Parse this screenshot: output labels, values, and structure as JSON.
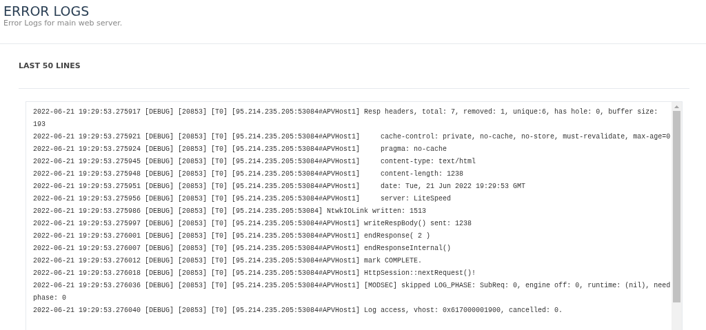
{
  "header": {
    "title": "ERROR LOGS",
    "subtitle": "Error Logs for main web server."
  },
  "panel": {
    "title": "LAST 50 LINES",
    "log_lines": [
      "2022-06-21 19:29:53.275917 [DEBUG] [20853] [T0] [95.214.235.205:53084#APVHost1] Resp headers, total: 7, removed: 1, unique:6, has hole: 0, buffer size: 193",
      "2022-06-21 19:29:53.275921 [DEBUG] [20853] [T0] [95.214.235.205:53084#APVHost1]     cache-control: private, no-cache, no-store, must-revalidate, max-age=0",
      "2022-06-21 19:29:53.275924 [DEBUG] [20853] [T0] [95.214.235.205:53084#APVHost1]     pragma: no-cache",
      "2022-06-21 19:29:53.275945 [DEBUG] [20853] [T0] [95.214.235.205:53084#APVHost1]     content-type: text/html",
      "2022-06-21 19:29:53.275948 [DEBUG] [20853] [T0] [95.214.235.205:53084#APVHost1]     content-length: 1238",
      "2022-06-21 19:29:53.275951 [DEBUG] [20853] [T0] [95.214.235.205:53084#APVHost1]     date: Tue, 21 Jun 2022 19:29:53 GMT",
      "2022-06-21 19:29:53.275956 [DEBUG] [20853] [T0] [95.214.235.205:53084#APVHost1]     server: LiteSpeed",
      "2022-06-21 19:29:53.275986 [DEBUG] [20853] [T0] [95.214.235.205:53084] NtwkIOLink written: 1513",
      "2022-06-21 19:29:53.275997 [DEBUG] [20853] [T0] [95.214.235.205:53084#APVHost1] writeRespBody() sent: 1238",
      "2022-06-21 19:29:53.276001 [DEBUG] [20853] [T0] [95.214.235.205:53084#APVHost1] endResponse( 2 )",
      "2022-06-21 19:29:53.276007 [DEBUG] [20853] [T0] [95.214.235.205:53084#APVHost1] endResponseInternal()",
      "2022-06-21 19:29:53.276012 [DEBUG] [20853] [T0] [95.214.235.205:53084#APVHost1] mark COMPLETE.",
      "2022-06-21 19:29:53.276018 [DEBUG] [20853] [T0] [95.214.235.205:53084#APVHost1] HttpSession::nextRequest()!",
      "2022-06-21 19:29:53.276036 [DEBUG] [20853] [T0] [95.214.235.205:53084#APVHost1] [MODSEC] skipped LOG_PHASE: SubReq: 0, engine off: 0, runtime: (nil), need phase: 0",
      "2022-06-21 19:29:53.276040 [DEBUG] [20853] [T0] [95.214.235.205:53084#APVHost1] Log access, vhost: 0x617000001900, cancelled: 0."
    ]
  }
}
